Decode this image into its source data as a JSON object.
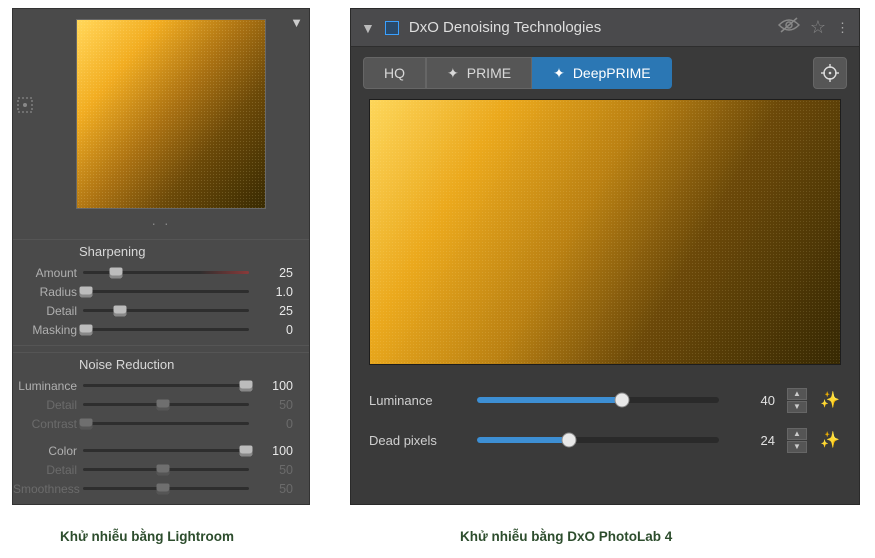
{
  "lightroom": {
    "sharpening_title": "Sharpening",
    "noise_title": "Noise Reduction",
    "sliders": {
      "amount": {
        "label": "Amount",
        "value": "25",
        "pos": 20,
        "enabled": true,
        "gradient": true
      },
      "radius": {
        "label": "Radius",
        "value": "1.0",
        "pos": 2,
        "enabled": true
      },
      "detail": {
        "label": "Detail",
        "value": "25",
        "pos": 22,
        "enabled": true
      },
      "masking": {
        "label": "Masking",
        "value": "0",
        "pos": 2,
        "enabled": true
      },
      "luminance": {
        "label": "Luminance",
        "value": "100",
        "pos": 98,
        "enabled": true
      },
      "l_detail": {
        "label": "Detail",
        "value": "50",
        "pos": 48,
        "enabled": false
      },
      "contrast": {
        "label": "Contrast",
        "value": "0",
        "pos": 2,
        "enabled": false
      },
      "color": {
        "label": "Color",
        "value": "100",
        "pos": 98,
        "enabled": true
      },
      "c_detail": {
        "label": "Detail",
        "value": "50",
        "pos": 48,
        "enabled": false
      },
      "smoothness": {
        "label": "Smoothness",
        "value": "50",
        "pos": 48,
        "enabled": false
      }
    }
  },
  "dxo": {
    "title": "DxO Denoising Technologies",
    "tabs": {
      "hq": "HQ",
      "prime": "PRIME",
      "deepprime": "DeepPRIME",
      "active": "deepprime"
    },
    "sliders": {
      "luminance": {
        "label": "Luminance",
        "value": "40",
        "pos": 60
      },
      "deadpixels": {
        "label": "Dead pixels",
        "value": "24",
        "pos": 38
      }
    }
  },
  "captions": {
    "left": "Khử nhiễu bằng Lightroom",
    "right": "Khử nhiễu bằng DxO PhotoLab 4"
  }
}
